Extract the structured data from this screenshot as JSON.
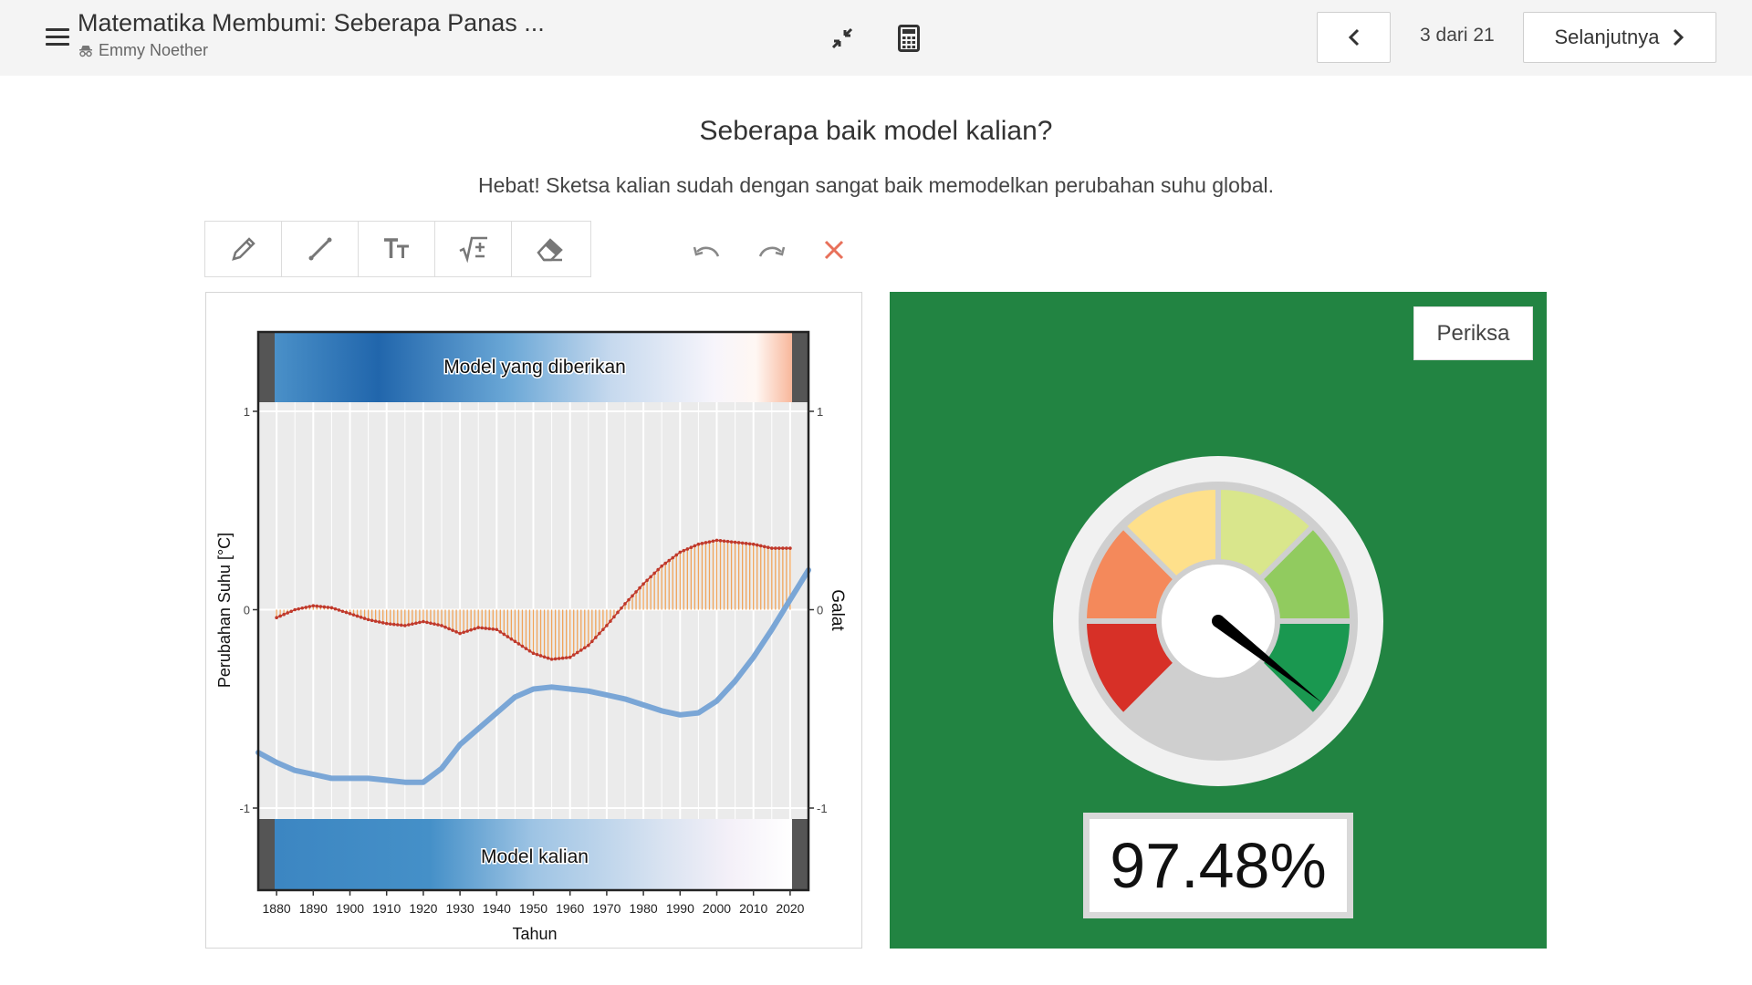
{
  "header": {
    "title": "Matematika Membumi: Seberapa Panas ...",
    "author": "Emmy Noether",
    "page_indicator": "3 dari 21",
    "next_label": "Selanjutnya"
  },
  "question": {
    "title": "Seberapa baik model kalian?",
    "subtitle": "Hebat! Sketsa kalian sudah dengan sangat baik memodelkan perubahan suhu global."
  },
  "toolbar": {
    "tools": [
      "pencil-icon",
      "line-icon",
      "text-icon",
      "math-icon",
      "eraser-icon"
    ],
    "actions": [
      "undo-icon",
      "redo-icon",
      "clear-icon"
    ]
  },
  "gauge": {
    "check_label": "Periksa",
    "score_text": "97.48%",
    "score_value": 0.9748
  },
  "chart_data": {
    "type": "line",
    "xlabel": "Tahun",
    "ylabel": "Perubahan Suhu [°C]",
    "y2label": "Galat",
    "xlim": [
      1875,
      2025
    ],
    "ylim": [
      -1,
      1
    ],
    "xticks": [
      1880,
      1890,
      1900,
      1910,
      1920,
      1930,
      1940,
      1950,
      1960,
      1970,
      1980,
      1990,
      2000,
      2010,
      2020
    ],
    "yticks": [
      -1,
      0,
      1
    ],
    "grid": true,
    "top_strip_label": "Model yang diberikan",
    "bottom_strip_label": "Model kalian",
    "series": [
      {
        "name": "Model kalian",
        "color": "#7aa6d6",
        "x": [
          1875,
          1880,
          1885,
          1890,
          1895,
          1900,
          1905,
          1910,
          1915,
          1920,
          1925,
          1930,
          1935,
          1940,
          1945,
          1950,
          1955,
          1960,
          1965,
          1970,
          1975,
          1980,
          1985,
          1990,
          1995,
          2000,
          2005,
          2010,
          2015,
          2020,
          2025
        ],
        "y": [
          -0.72,
          -0.77,
          -0.81,
          -0.83,
          -0.85,
          -0.85,
          -0.85,
          -0.86,
          -0.87,
          -0.87,
          -0.8,
          -0.68,
          -0.6,
          -0.52,
          -0.44,
          -0.4,
          -0.39,
          -0.4,
          -0.41,
          -0.43,
          -0.45,
          -0.48,
          -0.51,
          -0.53,
          -0.52,
          -0.46,
          -0.36,
          -0.24,
          -0.1,
          0.05,
          0.2
        ]
      },
      {
        "name": "Galat",
        "color": "#c0392b",
        "x": [
          1880,
          1885,
          1890,
          1895,
          1900,
          1905,
          1910,
          1915,
          1920,
          1925,
          1930,
          1935,
          1940,
          1945,
          1950,
          1955,
          1960,
          1965,
          1970,
          1975,
          1980,
          1985,
          1990,
          1995,
          2000,
          2005,
          2010,
          2015,
          2020
        ],
        "y": [
          -0.04,
          0.0,
          0.02,
          0.01,
          -0.02,
          -0.05,
          -0.07,
          -0.08,
          -0.06,
          -0.08,
          -0.12,
          -0.09,
          -0.1,
          -0.16,
          -0.22,
          -0.25,
          -0.24,
          -0.18,
          -0.08,
          0.03,
          0.13,
          0.22,
          0.29,
          0.33,
          0.35,
          0.34,
          0.33,
          0.31,
          0.31
        ]
      }
    ]
  }
}
